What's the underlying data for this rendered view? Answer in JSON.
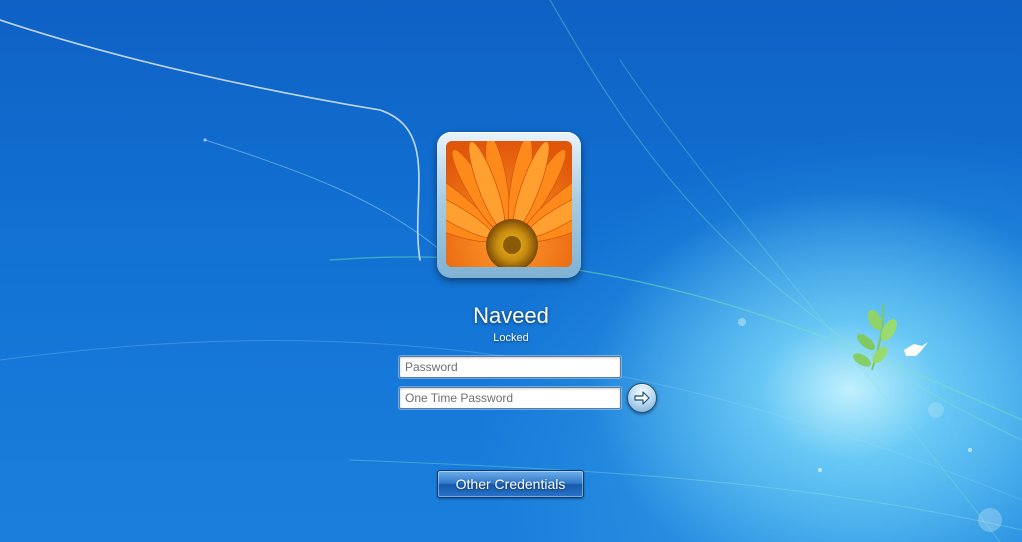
{
  "user": {
    "name": "Naveed",
    "status": "Locked"
  },
  "login": {
    "password_placeholder": "Password",
    "otp_placeholder": "One Time Password",
    "submit_icon": "arrow-right-icon"
  },
  "footer": {
    "other_credentials_label": "Other Credentials"
  },
  "wallpaper": {
    "logo_icon": "bird-and-leaves-icon"
  },
  "colors": {
    "background": "#1170d2",
    "glow": "#c8f5ff",
    "flower": "#f07a10"
  }
}
